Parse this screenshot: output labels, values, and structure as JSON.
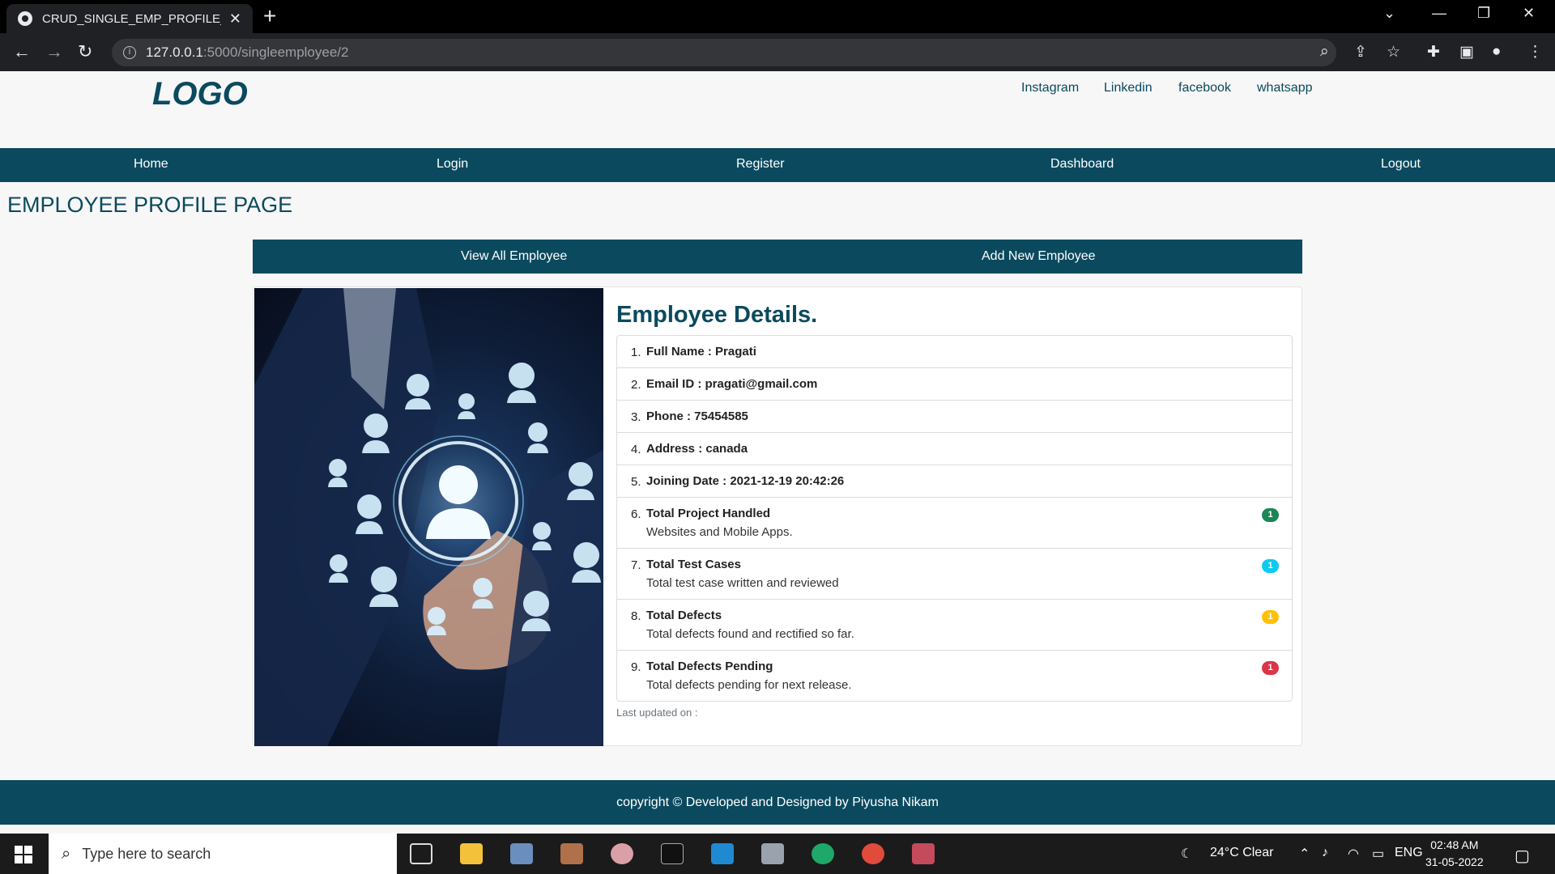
{
  "browser": {
    "tab_title": "CRUD_SINGLE_EMP_PROFILE_page",
    "url_host": "127.0.0.1",
    "url_path": ":5000/singleemployee/2"
  },
  "site": {
    "logo": "LOGO",
    "social": [
      "Instagram",
      "Linkedin",
      "facebook",
      "whatsapp"
    ],
    "nav": [
      "Home",
      "Login",
      "Register",
      "Dashboard",
      "Logout"
    ],
    "page_title": "EMPLOYEE PROFILE PAGE",
    "actions": [
      "View All Employee",
      "Add New Employee"
    ]
  },
  "details": {
    "title": "Employee Details.",
    "items": [
      {
        "num": "1.",
        "label": "Full Name : Pragati"
      },
      {
        "num": "2.",
        "label": "Email ID : pragati@gmail.com"
      },
      {
        "num": "3.",
        "label": "Phone : 75454585"
      },
      {
        "num": "4.",
        "label": "Address : canada"
      },
      {
        "num": "5.",
        "label": "Joining Date : 2021-12-19 20:42:26"
      },
      {
        "num": "6.",
        "label": "Total Project Handled",
        "sub": "Websites and Mobile Apps.",
        "badge": "1",
        "color": "#198754"
      },
      {
        "num": "7.",
        "label": "Total Test Cases",
        "sub": "Total test case written and reviewed",
        "badge": "1",
        "color": "#0dcaf0"
      },
      {
        "num": "8.",
        "label": "Total Defects",
        "sub": "Total defects found and rectified so far.",
        "badge": "1",
        "color": "#ffc107"
      },
      {
        "num": "9.",
        "label": "Total Defects Pending",
        "sub": "Total defects pending for next release.",
        "badge": "1",
        "color": "#dc3545"
      }
    ],
    "updated": "Last updated on :"
  },
  "footer": "copyright © Developed and Designed by Piyusha Nikam",
  "taskbar": {
    "search_placeholder": "Type here to search",
    "weather": "24°C  Clear",
    "lang": "ENG",
    "time": "02:48 AM",
    "date": "31-05-2022"
  },
  "colors": {
    "brand": "#0b4a5e"
  }
}
